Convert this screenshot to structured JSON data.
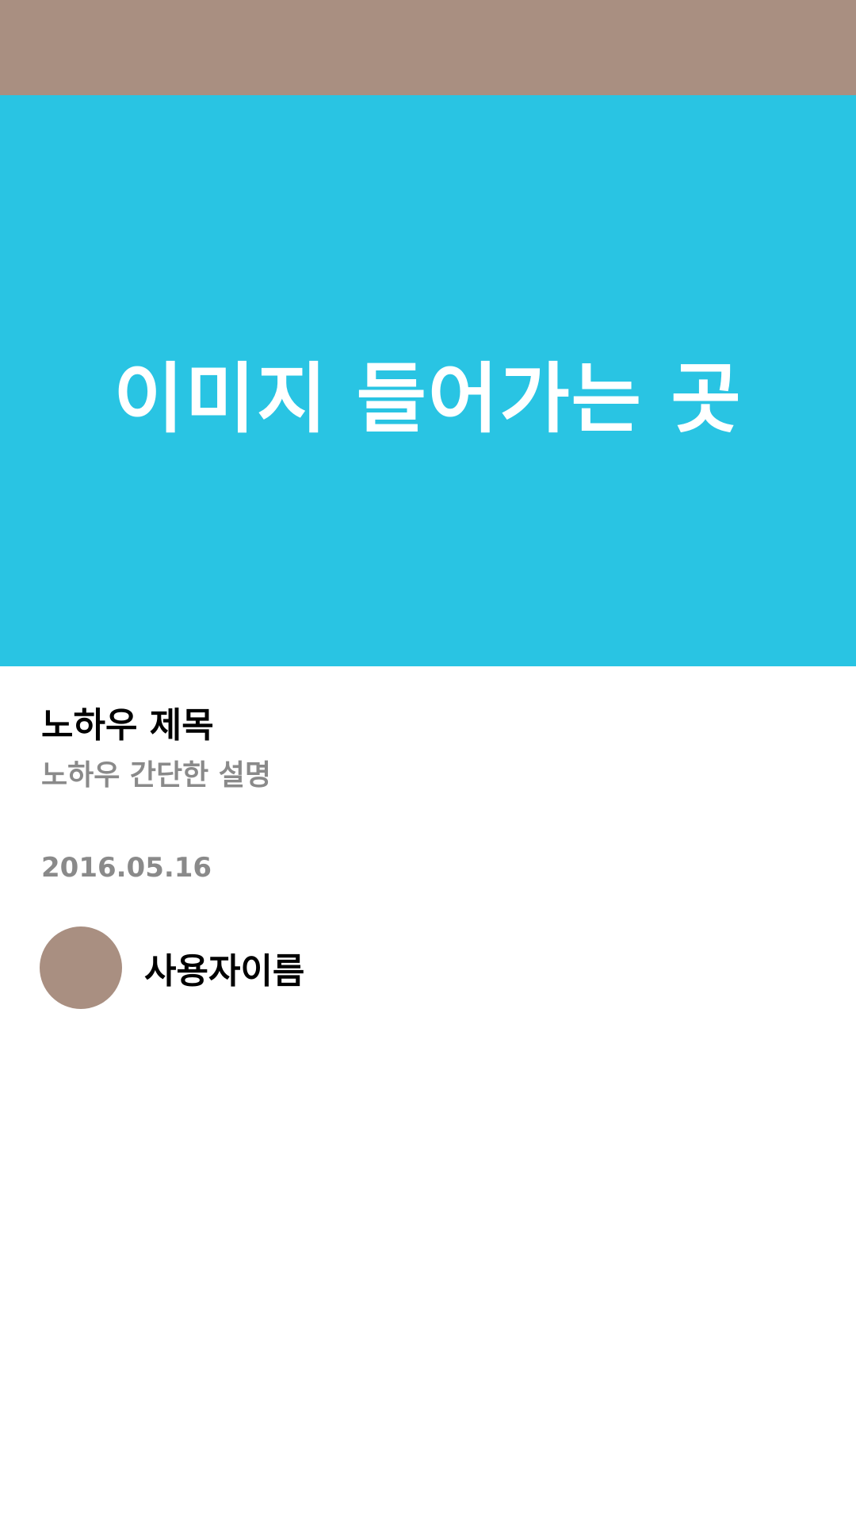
{
  "colors": {
    "top_bar": "#a98f81",
    "image_area": "#29c4e3",
    "avatar": "#a98f81",
    "title_text": "#000000",
    "secondary_text": "#8a8a8a"
  },
  "hero": {
    "placeholder_text": "이미지 들어가는 곳"
  },
  "post": {
    "title": "노하우 제목",
    "description": "노하우 간단한 설명",
    "date": "2016.05.16"
  },
  "author": {
    "name": "사용자이름"
  }
}
